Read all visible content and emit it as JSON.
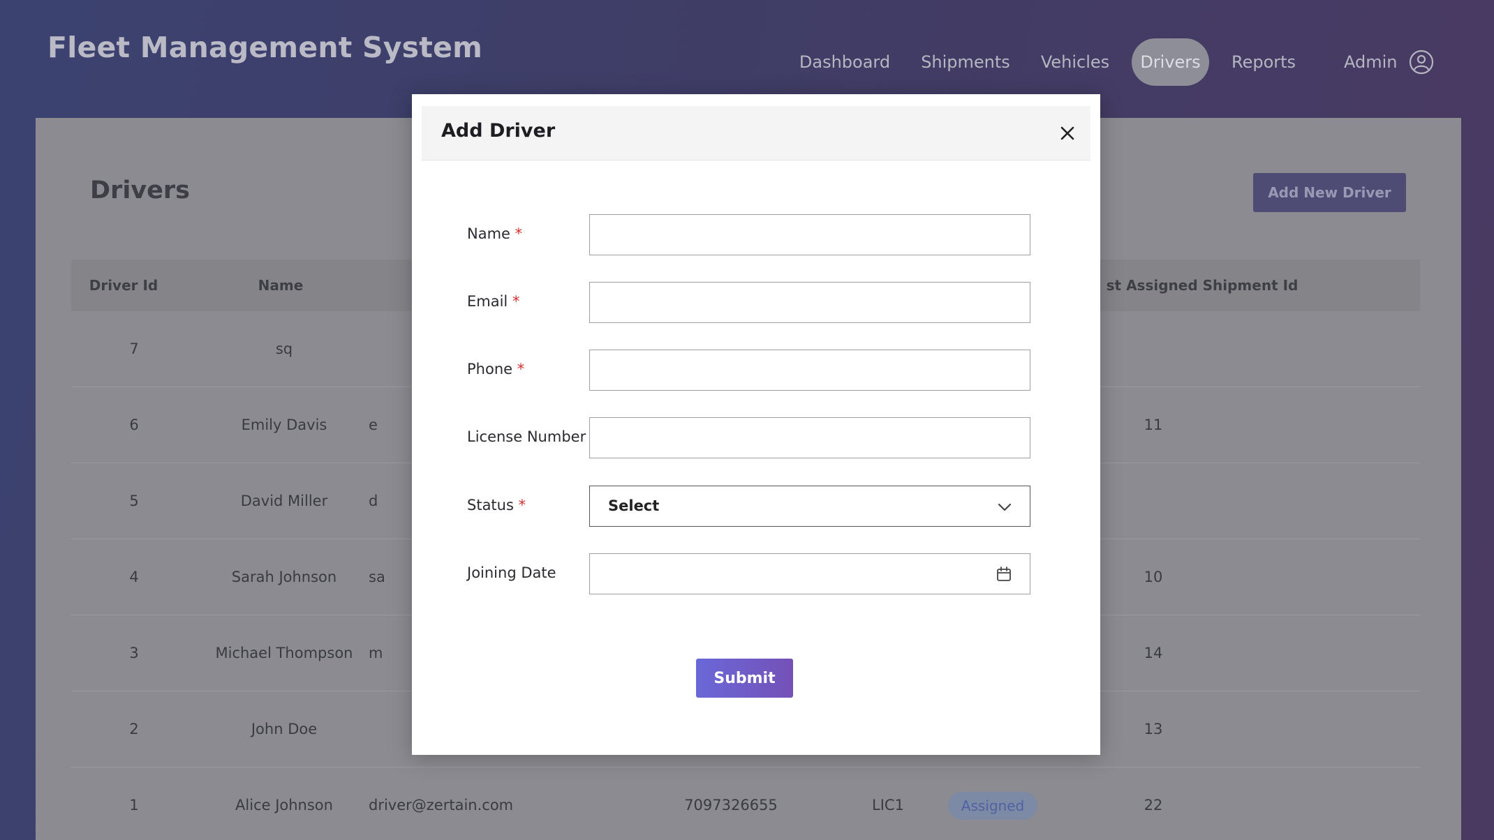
{
  "app": {
    "title": "Fleet Management System"
  },
  "nav": {
    "items": [
      {
        "label": "Dashboard"
      },
      {
        "label": "Shipments"
      },
      {
        "label": "Vehicles"
      },
      {
        "label": "Drivers",
        "active": true
      },
      {
        "label": "Reports"
      }
    ],
    "admin_label": "Admin"
  },
  "page": {
    "title": "Drivers",
    "add_button": "Add New Driver"
  },
  "table": {
    "headers": {
      "id": "Driver Id",
      "name": "Name",
      "shipment": "st Assigned Shipment Id"
    },
    "rows": [
      {
        "id": "7",
        "name": "sq",
        "email": "",
        "phone": "",
        "license": "",
        "status": "",
        "shipment": ""
      },
      {
        "id": "6",
        "name": "Emily Davis",
        "email": "e",
        "phone": "",
        "license": "",
        "status": "",
        "shipment": "11"
      },
      {
        "id": "5",
        "name": "David Miller",
        "email": "d",
        "phone": "",
        "license": "",
        "status": "",
        "shipment": ""
      },
      {
        "id": "4",
        "name": "Sarah Johnson",
        "email": "sa",
        "phone": "",
        "license": "",
        "status": "",
        "shipment": "10"
      },
      {
        "id": "3",
        "name": "Michael Thompson",
        "email": "m",
        "phone": "",
        "license": "",
        "status": "",
        "shipment": "14"
      },
      {
        "id": "2",
        "name": "John Doe",
        "email": "",
        "phone": "",
        "license": "",
        "status": "",
        "shipment": "13"
      },
      {
        "id": "1",
        "name": "Alice Johnson",
        "email": "driver@zertain.com",
        "phone": "7097326655",
        "license": "LIC1",
        "status": "Assigned",
        "shipment": "22"
      }
    ]
  },
  "modal": {
    "title": "Add Driver",
    "fields": {
      "name": {
        "label": "Name",
        "required": "*",
        "value": ""
      },
      "email": {
        "label": "Email",
        "required": "*",
        "value": ""
      },
      "phone": {
        "label": "Phone",
        "required": "*",
        "value": ""
      },
      "license": {
        "label": "License Number",
        "value": ""
      },
      "status": {
        "label": "Status",
        "required": "*",
        "selected": "Select"
      },
      "joining_date": {
        "label": "Joining Date",
        "value": ""
      }
    },
    "submit_label": "Submit"
  },
  "icons": {
    "close": "close-icon",
    "chevron": "chevron-down-icon",
    "calendar": "calendar-icon",
    "admin": "user-circle-icon"
  },
  "colors": {
    "accent": "#6a68d8",
    "required": "#d32f2f",
    "status_assigned": "#5161a2"
  }
}
